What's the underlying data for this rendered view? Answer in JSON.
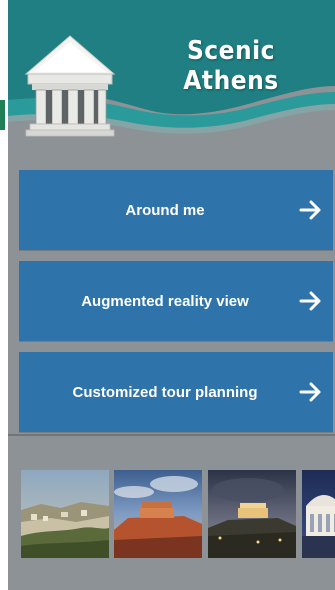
{
  "app": {
    "title": "Scenic Athens"
  },
  "menu": {
    "items": [
      {
        "label": "Around me",
        "icon": "arrow-right-icon"
      },
      {
        "label": "Augmented reality view",
        "icon": "arrow-right-icon"
      },
      {
        "label": "Customized tour planning",
        "icon": "arrow-right-icon"
      }
    ]
  },
  "gallery": {
    "photos": [
      {
        "name": "athens-city-panorama"
      },
      {
        "name": "acropolis-at-sunset"
      },
      {
        "name": "acropolis-at-night"
      },
      {
        "name": "domed-building"
      }
    ]
  },
  "colors": {
    "teal": "#1f7f82",
    "header_bg": "#8c9296",
    "button_blue": "#2e74ab",
    "text_white": "#ffffff"
  }
}
